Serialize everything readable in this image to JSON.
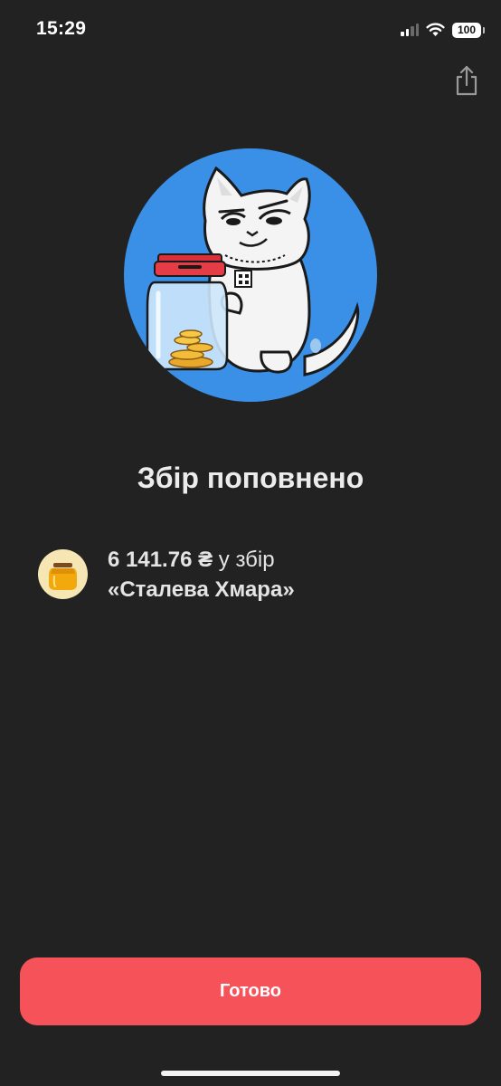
{
  "status_bar": {
    "time": "15:29",
    "battery": "100",
    "icons": [
      "cellular-signal-icon",
      "wifi-icon",
      "battery-icon"
    ]
  },
  "header": {
    "share_icon": "share-icon"
  },
  "hero": {
    "illustration": "cat-with-coin-jar",
    "background_color": "#3a8fe6"
  },
  "title": "Збір поповнено",
  "transfer": {
    "icon": "jar-icon",
    "amount": "6 141.76 ₴",
    "target_text": "у збір",
    "jar_name": "«Сталева Хмара»"
  },
  "done_button": {
    "label": "Готово",
    "color": "#f6525a"
  }
}
